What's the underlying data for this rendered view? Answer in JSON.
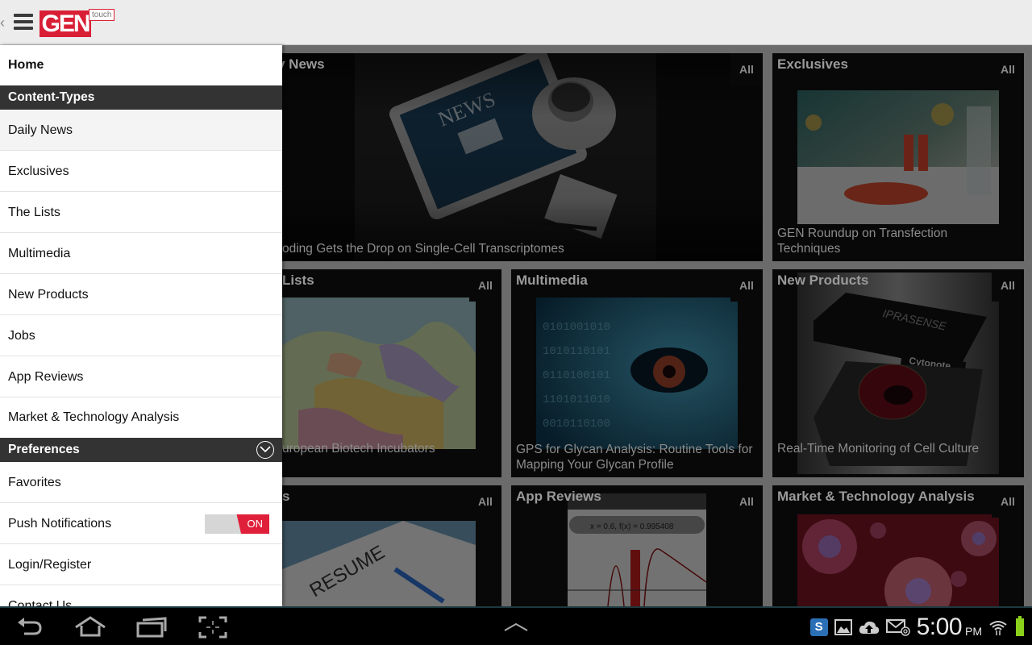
{
  "app": {
    "logo_text": "GEN",
    "logo_badge": "touch",
    "brand_color": "#d81f36"
  },
  "drawer": {
    "home": "Home",
    "content_types_header": "Content-Types",
    "content_types": [
      {
        "label": "Daily News",
        "active": true
      },
      {
        "label": "Exclusives"
      },
      {
        "label": "The Lists"
      },
      {
        "label": "Multimedia"
      },
      {
        "label": "New Products"
      },
      {
        "label": "Jobs"
      },
      {
        "label": "App Reviews"
      },
      {
        "label": "Market & Technology Analysis"
      }
    ],
    "preferences_header": "Preferences",
    "preferences": [
      {
        "label": "Favorites"
      },
      {
        "label": "Push Notifications",
        "toggle": "ON",
        "toggle_state": true
      },
      {
        "label": "Login/Register"
      },
      {
        "label": "Contact Us"
      }
    ],
    "toggle_color": "#e0203a"
  },
  "tiles": [
    {
      "title": "Daily News",
      "visible_title": "y News",
      "all": "All",
      "caption": "oding Gets the Drop on Single-Cell Transcriptomes"
    },
    {
      "title": "Exclusives",
      "all": "All",
      "caption": "GEN Roundup on Transfection Techniques"
    },
    {
      "title": "The Lists",
      "visible_title": "Lists",
      "all": "All",
      "caption": "uropean Biotech Incubators"
    },
    {
      "title": "Multimedia",
      "all": "All",
      "caption": "GPS for Glycan Analysis: Routine Tools for Mapping Your Glycan Profile"
    },
    {
      "title": "New Products",
      "all": "All",
      "caption": "Real-Time Monitoring of Cell Culture"
    },
    {
      "title": "Jobs",
      "visible_title": "s",
      "all": "All",
      "caption": ""
    },
    {
      "title": "App Reviews",
      "all": "All",
      "caption": ""
    },
    {
      "title": "Market & Technology Analysis",
      "all": "All",
      "caption": ""
    }
  ],
  "images": {
    "news_tablet_text": "NEWS",
    "cytonote_brand": "IPRASENSE",
    "cytonote_label": "Cytonote",
    "resume_text": "RESUME",
    "app_review_formula": "x = 0.6, f(x) = 0.995408"
  },
  "status_bar": {
    "time": "5:00",
    "ampm": "PM",
    "notification_icons": [
      "skype-icon",
      "gallery-icon",
      "cloud-upload-icon",
      "email-icon"
    ],
    "battery_color": "#8bd11b"
  },
  "navigation": [
    "back",
    "home",
    "recent-apps",
    "screenshot"
  ]
}
